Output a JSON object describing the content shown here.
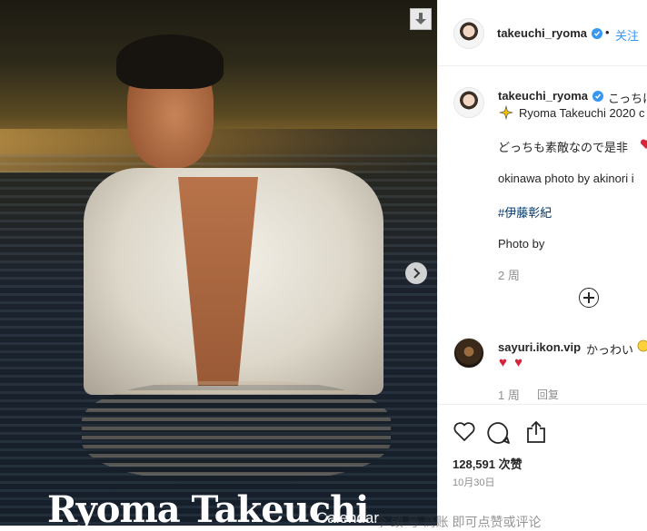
{
  "photo": {
    "headline": "Ryoma Takeuchi",
    "headline_sub": "Calendar"
  },
  "header": {
    "username": "takeuchi_ryoma",
    "follow_label": "关注",
    "separator": "•"
  },
  "caption": {
    "username": "takeuchi_ryoma",
    "text_start": "こっちは",
    "line2": "Ryoma Takeuchi 2020 c",
    "line3": "どっちも素敵なので是非",
    "line4": "okinawa photo by akinori i",
    "hashtag": "#伊藤彰紀",
    "line6": "Photo by",
    "age": "2 周"
  },
  "comment": {
    "username": "sayuri.ikon.vip",
    "text": "かっわい",
    "hearts": "♥ ♥",
    "age": "1 周",
    "reply_label": "回复"
  },
  "stats": {
    "likes": "128,591 次赞",
    "date": "10月30日"
  },
  "watermark": {
    "text": "今 頭 号  商账 即可点赞或评论"
  },
  "colors": {
    "accent": "#3897f0",
    "heart": "#ed4956"
  },
  "icons": {
    "download": "download-icon",
    "next": "chevron-right-icon",
    "verified": "verified-badge-icon",
    "like": "heart-icon",
    "comment": "comment-icon",
    "share": "share-icon",
    "load_more": "plus-circle-icon"
  }
}
